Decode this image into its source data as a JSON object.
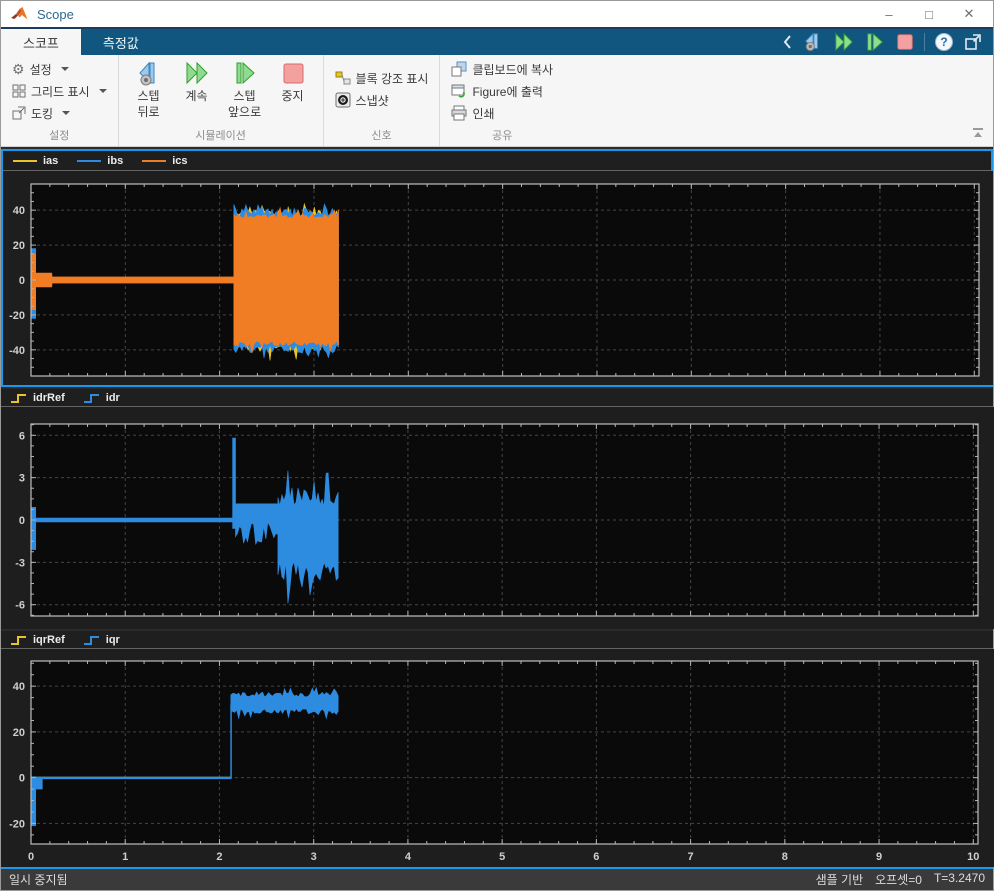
{
  "window": {
    "title": "Scope"
  },
  "window_controls": {
    "minimize": "–",
    "maximize": "□",
    "close": "✕"
  },
  "tabs": {
    "scope": "스코프",
    "measurements": "측정값"
  },
  "ribbon": {
    "settings": {
      "caption": "설정",
      "config_label": "설정",
      "grid_label": "그리드 표시",
      "dock_label": "도킹"
    },
    "simulation": {
      "caption": "시뮬레이션",
      "step_back_1": "스텝",
      "step_back_2": "뒤로",
      "continue_label": "계속",
      "step_fwd_1": "스텝",
      "step_fwd_2": "앞으로",
      "stop_label": "중지"
    },
    "signal": {
      "caption": "신호",
      "highlight_label": "블록 강조 표시",
      "snapshot_label": "스냅샷"
    },
    "share": {
      "caption": "공유",
      "copy_label": "클립보드에 복사",
      "figure_label": "Figure에 출력",
      "print_label": "인쇄"
    }
  },
  "status": {
    "left": "일시 중지됨",
    "sample": "샘플 기반",
    "offset": "오프셋=0",
    "time": "T=3.2470"
  },
  "colors": {
    "accent": "#1b98ee",
    "signal_yellow": "#e9c32a",
    "signal_blue": "#2e8ce0",
    "signal_orange": "#f07d23",
    "plot_bg": "#0a0a0a",
    "panel_bg": "#1e1e1e",
    "grid": "#454545"
  },
  "chart_data": [
    {
      "type": "line",
      "title": "three-phase stator currents",
      "xlim": [
        0,
        10.05
      ],
      "ylim": [
        -55,
        55
      ],
      "xticks": [
        0,
        1,
        2,
        3,
        4,
        5,
        6,
        7,
        8,
        9,
        10
      ],
      "yticks": [
        40,
        20,
        0,
        -20,
        -40
      ],
      "xminor": 0.2,
      "yminor": 5,
      "grid": true,
      "show_xlabels": false,
      "legend_position": "top-left",
      "legend": [
        {
          "label": "ias",
          "color": "#e9c32a",
          "swatch": "line"
        },
        {
          "label": "ibs",
          "color": "#2e8ce0",
          "swatch": "line"
        },
        {
          "label": "ics",
          "color": "#f07d23",
          "swatch": "line"
        }
      ],
      "series": [
        {
          "name": "ias",
          "color": "#e9c32a",
          "segments": [
            {
              "x0": 0,
              "x1": 0.05,
              "min": -20,
              "max": 17
            },
            {
              "x0": 0.05,
              "x1": 0.22,
              "min": -3,
              "max": 3
            },
            {
              "x0": 0.22,
              "x1": 2.15,
              "min": -1.3,
              "max": 1.3
            },
            {
              "x0": 2.15,
              "x1": 3.26,
              "min": -41,
              "max": 40,
              "jitter": 5,
              "spike": 6
            }
          ]
        },
        {
          "name": "ibs",
          "color": "#2e8ce0",
          "segments": [
            {
              "x0": 0,
              "x1": 0.05,
              "min": -22,
              "max": 18
            },
            {
              "x0": 0.05,
              "x1": 0.22,
              "min": -3.5,
              "max": 3.5
            },
            {
              "x0": 0.22,
              "x1": 2.15,
              "min": -1.5,
              "max": 1.5
            },
            {
              "x0": 2.15,
              "x1": 3.26,
              "min": -42,
              "max": 41,
              "jitter": 5,
              "spike": 6
            }
          ]
        },
        {
          "name": "ics",
          "color": "#f07d23",
          "segments": [
            {
              "x0": 0,
              "x1": 0.05,
              "min": -17,
              "max": 15
            },
            {
              "x0": 0.05,
              "x1": 0.22,
              "min": -4,
              "max": 4
            },
            {
              "x0": 0.22,
              "x1": 2.15,
              "min": -1.8,
              "max": 1.8
            },
            {
              "x0": 2.15,
              "x1": 3.26,
              "min": -38,
              "max": 38,
              "jitter": 3,
              "spike": 4
            }
          ]
        }
      ]
    },
    {
      "type": "line",
      "title": "d-axis rotor current vs reference",
      "xlim": [
        0,
        10.05
      ],
      "ylim": [
        -6.8,
        6.8
      ],
      "xticks": [
        0,
        1,
        2,
        3,
        4,
        5,
        6,
        7,
        8,
        9,
        10
      ],
      "yticks": [
        6,
        3,
        0,
        -3,
        -6
      ],
      "xminor": 0.2,
      "yminor": 0.75,
      "grid": true,
      "show_xlabels": false,
      "legend_position": "top-left",
      "legend": [
        {
          "label": "idrRef",
          "color": "#e9c32a",
          "swatch": "step"
        },
        {
          "label": "idr",
          "color": "#2e8ce0",
          "swatch": "step"
        }
      ],
      "series": [
        {
          "name": "idrRef",
          "color": "#e9c32a",
          "segments": [
            {
              "x0": 0,
              "x1": 3.26,
              "min": -0.06,
              "max": 0.06
            }
          ]
        },
        {
          "name": "idr",
          "color": "#2e8ce0",
          "segments": [
            {
              "x0": 0,
              "x1": 0.05,
              "min": -2.1,
              "max": 0.9
            },
            {
              "x0": 0.05,
              "x1": 2.14,
              "min": -0.14,
              "max": 0.14
            },
            {
              "x0": 2.14,
              "x1": 2.17,
              "min": -0.6,
              "max": 5.8
            },
            {
              "x0": 2.17,
              "x1": 2.62,
              "min": -1.9,
              "max": 1.15,
              "jitter": 1.8,
              "jitter_side": "min",
              "spike": 2.2
            },
            {
              "x0": 2.62,
              "x1": 3.26,
              "min": -4.3,
              "max": 2.35,
              "jitter": 1.4,
              "spike": 1.6
            }
          ]
        }
      ]
    },
    {
      "type": "line",
      "title": "q-axis rotor current vs reference",
      "xlim": [
        0,
        10.05
      ],
      "ylim": [
        -29,
        51
      ],
      "xticks": [
        0,
        1,
        2,
        3,
        4,
        5,
        6,
        7,
        8,
        9,
        10
      ],
      "yticks": [
        40,
        20,
        0,
        -20
      ],
      "xminor": 0.2,
      "yminor": 5,
      "grid": true,
      "show_xlabels": true,
      "legend_position": "top-left",
      "legend": [
        {
          "label": "iqrRef",
          "color": "#e9c32a",
          "swatch": "step"
        },
        {
          "label": "iqr",
          "color": "#2e8ce0",
          "swatch": "step"
        }
      ],
      "series": [
        {
          "name": "iqrRef",
          "color": "#e9c32a",
          "segments": [
            {
              "x0": 0,
              "x1": 2.12,
              "min": -0.06,
              "max": 0.06
            },
            {
              "x0": 2.12,
              "x1": 3.26,
              "min": 32.8,
              "max": 33.2
            }
          ]
        },
        {
          "name": "iqr",
          "color": "#2e8ce0",
          "segments": [
            {
              "x0": 0,
              "x1": 0.05,
              "min": -21,
              "max": 0.4
            },
            {
              "x0": 0.05,
              "x1": 0.12,
              "min": -5,
              "max": 0.3
            },
            {
              "x0": 0.12,
              "x1": 2.118,
              "min": -0.5,
              "max": 0.25
            },
            {
              "x0": 2.118,
              "x1": 2.128,
              "min": -0.3,
              "max": 32
            },
            {
              "x0": 2.12,
              "x1": 3.26,
              "min": 28,
              "max": 37.5,
              "jitter": 2.2,
              "spike": 2.5
            }
          ]
        }
      ]
    }
  ]
}
